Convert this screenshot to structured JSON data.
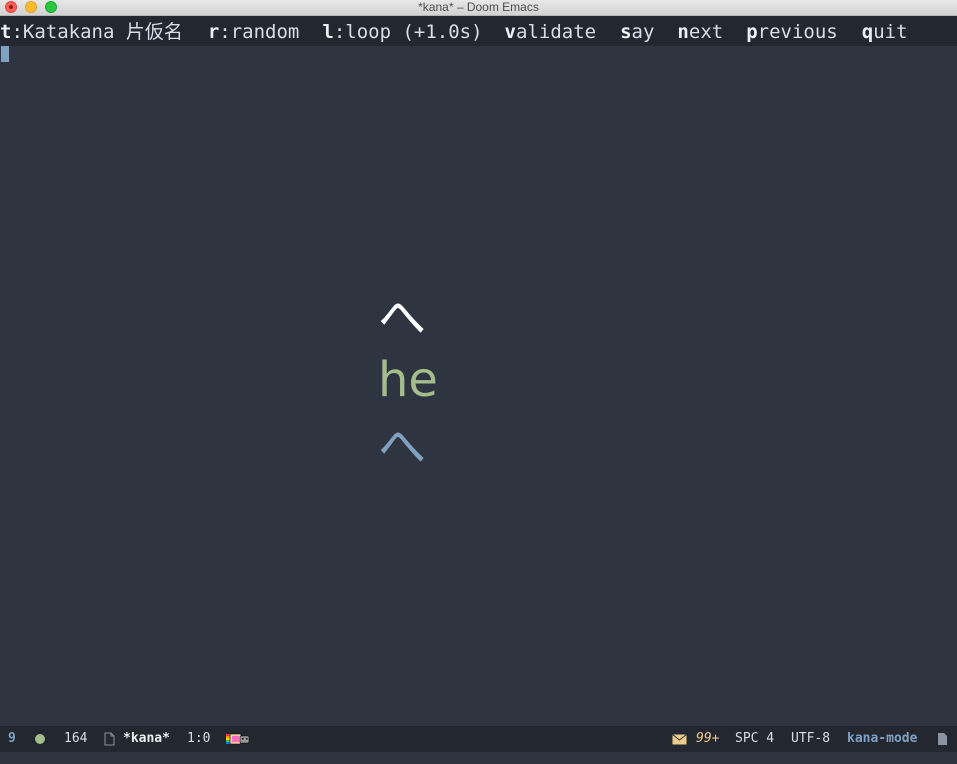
{
  "window": {
    "title": "*kana* – Doom Emacs"
  },
  "header": {
    "items": [
      {
        "key": "t",
        "rest": ":Katakana 片仮名"
      },
      {
        "key": "r",
        "rest": ":random"
      },
      {
        "key": "l",
        "rest": ":loop (+1.0s)"
      },
      {
        "key": "v",
        "rest": "alidate"
      },
      {
        "key": "s",
        "rest": "ay"
      },
      {
        "key": "n",
        "rest": "ext"
      },
      {
        "key": "p",
        "rest": "revious"
      },
      {
        "key": "q",
        "rest": "uit"
      }
    ]
  },
  "kana": {
    "character": "へ",
    "romaji": "he",
    "answer": "へ"
  },
  "modeline": {
    "window_number": "9",
    "buffer_size": "164",
    "buffer_name": "*kana*",
    "position": "1:0",
    "mail_count": "99+",
    "indent": "SPC 4",
    "encoding": "UTF-8",
    "major_mode": "kana-mode"
  },
  "colors": {
    "background": "#2e3440",
    "header_bg": "#222730",
    "kana": "#ffffff",
    "romaji": "#a3be8c",
    "answer": "#81a1c1",
    "mode_name": "#81a1c1",
    "mail_count": "#ebcb8b"
  },
  "icons": {
    "status_dot": "green-circle-icon",
    "file": "file-icon",
    "cat": "nyan-cat-icon",
    "mail": "mail-icon",
    "end": "file-icon"
  }
}
